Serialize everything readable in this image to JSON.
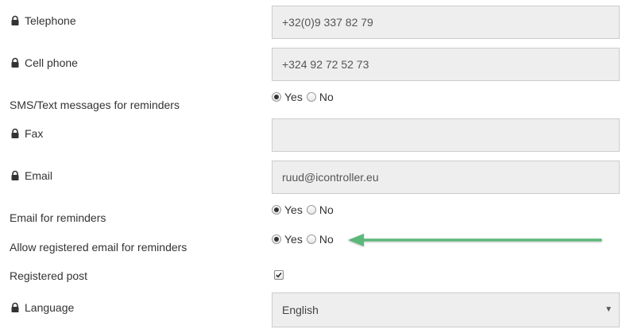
{
  "fields": {
    "telephone": {
      "label": "Telephone",
      "value": "+32(0)9 337 82 79",
      "locked": true
    },
    "cell_phone": {
      "label": "Cell phone",
      "value": "+324 92 72 52 73",
      "locked": true
    },
    "sms_reminders": {
      "label": "SMS/Text messages for reminders",
      "selected": "Yes"
    },
    "fax": {
      "label": "Fax",
      "value": "",
      "locked": true
    },
    "email": {
      "label": "Email",
      "value": "ruud@icontroller.eu",
      "locked": true
    },
    "email_reminders": {
      "label": "Email for reminders",
      "selected": "Yes"
    },
    "registered_email_reminders": {
      "label": "Allow registered email for reminders",
      "selected": "Yes"
    },
    "registered_post": {
      "label": "Registered post",
      "checked": true
    },
    "language": {
      "label": "Language",
      "value": "English",
      "locked": true
    }
  },
  "options": {
    "yes": "Yes",
    "no": "No"
  },
  "colors": {
    "field_bg": "#eeeeee",
    "field_border": "#cccccc",
    "text": "#333333",
    "annotation_arrow": "#5cb87a"
  }
}
